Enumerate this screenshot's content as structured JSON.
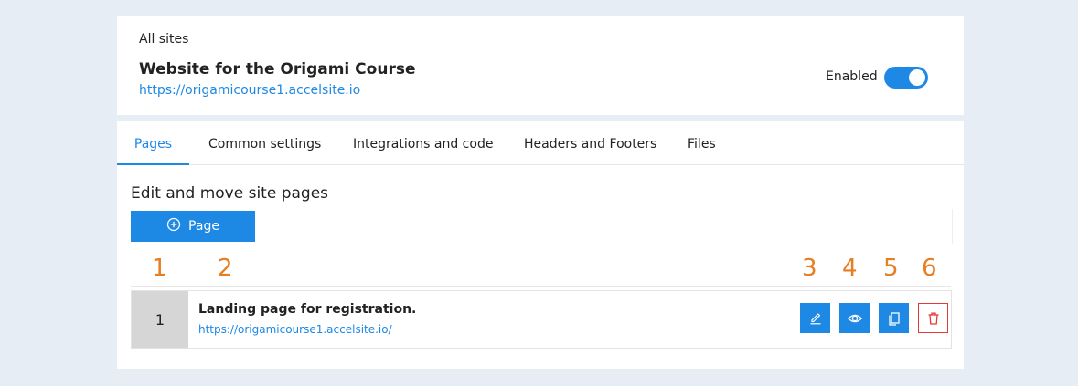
{
  "header": {
    "breadcrumb": "All sites",
    "site_title": "Website for the Origami Course",
    "site_url": "https://origamicourse1.accelsite.io",
    "status_label": "Enabled"
  },
  "tabs": [
    {
      "label": "Pages"
    },
    {
      "label": "Common settings"
    },
    {
      "label": "Integrations and code"
    },
    {
      "label": "Headers and Footers"
    },
    {
      "label": "Files"
    }
  ],
  "main": {
    "heading": "Edit and move site pages",
    "add_button_label": "Page"
  },
  "markers": [
    "1",
    "2",
    "3",
    "4",
    "5",
    "6"
  ],
  "pages": [
    {
      "number": "1",
      "title": "Landing page for registration.",
      "url": "https://origamicourse1.accelsite.io/"
    }
  ],
  "colors": {
    "accent": "#1e88e5",
    "danger": "#e53935",
    "marker": "#e67e22",
    "background": "#e7edf5"
  }
}
